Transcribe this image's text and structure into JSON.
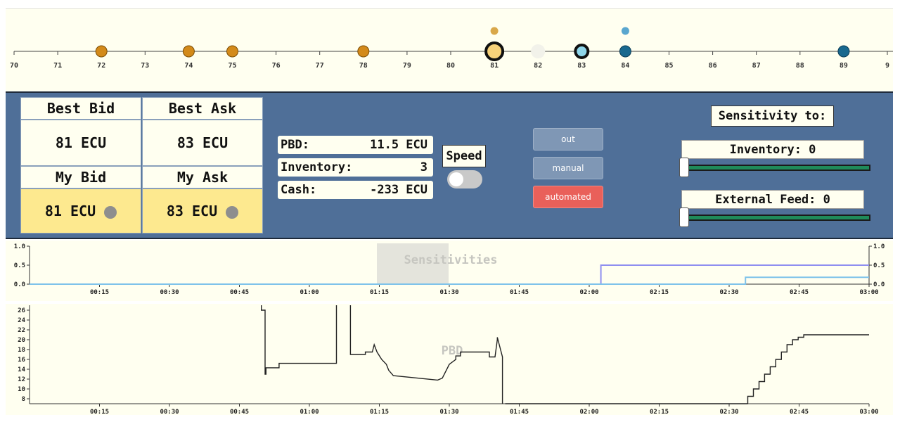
{
  "ladder": {
    "ticks": [
      "70",
      "71",
      "72",
      "73",
      "74",
      "75",
      "76",
      "77",
      "78",
      "79",
      "80",
      "81",
      "82",
      "83",
      "84",
      "85",
      "86",
      "87",
      "88",
      "89",
      "9"
    ],
    "range": [
      70,
      90
    ],
    "orders": [
      {
        "price": 72,
        "kind": "orange"
      },
      {
        "price": 74,
        "kind": "orange"
      },
      {
        "price": 75,
        "kind": "orange"
      },
      {
        "price": 78,
        "kind": "orange"
      },
      {
        "price": 81,
        "kind": "my-bid"
      },
      {
        "price": 82,
        "kind": "ghost"
      },
      {
        "price": 83,
        "kind": "my-ask"
      },
      {
        "price": 84,
        "kind": "blue"
      },
      {
        "price": 89,
        "kind": "blue"
      }
    ],
    "markers": [
      {
        "price": 81,
        "kind": "orange"
      },
      {
        "price": 84,
        "kind": "blue"
      }
    ],
    "colors": {
      "orange": "#d38a1a",
      "blue": "#19698f",
      "ghost": "#f2f2ea",
      "my_bid": "#f7d27a",
      "my_ask": "#8fd6ea",
      "marker_orange": "#d9a84a",
      "marker_blue": "#5aa7cf"
    }
  },
  "quotes": {
    "best_bid_label": "Best Bid",
    "best_ask_label": "Best Ask",
    "best_bid_value": "81 ECU",
    "best_ask_value": "83 ECU",
    "my_bid_label": "My Bid",
    "my_ask_label": "My Ask",
    "my_bid_value": "81 ECU",
    "my_ask_value": "83 ECU"
  },
  "stats": {
    "pbd_label": "PBD:",
    "pbd_value": "11.5 ECU",
    "inventory_label": "Inventory:",
    "inventory_value": "3",
    "cash_label": "Cash:",
    "cash_value": "-233 ECU"
  },
  "speed": {
    "label": "Speed",
    "on": false
  },
  "modes": {
    "out": "out",
    "manual": "manual",
    "automated": "automated",
    "selected": "automated"
  },
  "sensitivity": {
    "title": "Sensitivity to:",
    "inventory_label": "Inventory: 0",
    "inventory_level": 0,
    "external_label": "External Feed: 0",
    "external_level": 0
  },
  "sens_chart": {
    "title": "Sensitivities",
    "y_ticks": [
      "1.0",
      "0.5",
      "0.0"
    ],
    "x_ticks": [
      "00:15",
      "00:30",
      "00:45",
      "01:00",
      "01:15",
      "01:30",
      "01:45",
      "02:00",
      "02:15",
      "02:30",
      "02:45",
      "03:00"
    ]
  },
  "pbd_chart": {
    "title": "PBD",
    "y_ticks": [
      "26",
      "24",
      "22",
      "20",
      "18",
      "16",
      "14",
      "12",
      "10",
      "8"
    ],
    "x_ticks": [
      "00:15",
      "00:30",
      "00:45",
      "01:00",
      "01:15",
      "01:30",
      "01:45",
      "02:00",
      "02:15",
      "02:30",
      "02:45",
      "03:00"
    ]
  },
  "chart_data": [
    {
      "type": "line",
      "title": "Sensitivities",
      "xlabel": "",
      "ylabel": "",
      "xlim": [
        0,
        180
      ],
      "ylim": [
        0,
        1
      ],
      "grid": false,
      "series": [
        {
          "color": "#8f8ff0",
          "x": [
            0,
            122.5,
            122.5,
            180
          ],
          "y": [
            0,
            0,
            0.5,
            0.5
          ]
        },
        {
          "color": "#7fc3ea",
          "x": [
            0,
            153.5,
            153.5,
            180
          ],
          "y": [
            0,
            0,
            0.18,
            0.18
          ]
        }
      ]
    },
    {
      "type": "line",
      "title": "PBD",
      "xlabel": "",
      "ylabel": "",
      "xlim": [
        0,
        180
      ],
      "ylim": [
        7,
        27
      ],
      "grid": false,
      "series": [
        {
          "color": "#222222",
          "segments": [
            {
              "x": [
                49.7,
                49.7,
                50.5,
                50.5,
                50.7,
                50.7,
                53.5,
                53.5,
                65.8,
                65.8
              ],
              "y": [
                27,
                26,
                26,
                13,
                13,
                14.3,
                14.3,
                15.2,
                15.2,
                27
              ]
            },
            {
              "x": [
                68.8,
                68.8,
                72,
                72,
                73.5,
                73.9,
                74.5,
                75.5,
                76.5,
                77,
                78,
                87.5,
                88.5,
                90,
                91.4,
                91.4,
                92.4,
                92.4,
                98.6,
                98.6,
                99.8,
                100.3,
                100.3,
                101.4,
                101.4
              ],
              "y": [
                27,
                17,
                17,
                17.5,
                17.5,
                19,
                17.5,
                16,
                15,
                13.8,
                12.7,
                11.8,
                12.2,
                15,
                16,
                16.7,
                16.7,
                17.5,
                17.5,
                16.5,
                16.5,
                20,
                20.5,
                16.5,
                7
              ]
            },
            {
              "x": [
                102,
                154
              ],
              "y": [
                7,
                7
              ]
            },
            {
              "x": [
                154,
                154,
                155.2,
                155.2,
                156.4,
                156.4,
                157.6,
                157.6,
                158.8,
                158.8,
                160,
                160,
                161.2,
                161.2,
                162.4,
                162.4,
                163.6,
                163.6,
                164.8,
                164.8,
                166,
                166,
                180
              ],
              "y": [
                7,
                8.5,
                8.5,
                10,
                10,
                11.5,
                11.5,
                13,
                13,
                14.5,
                14.5,
                16,
                16,
                17.5,
                17.5,
                19,
                19,
                20,
                20,
                20.5,
                20.5,
                21,
                21
              ]
            }
          ]
        }
      ]
    }
  ]
}
